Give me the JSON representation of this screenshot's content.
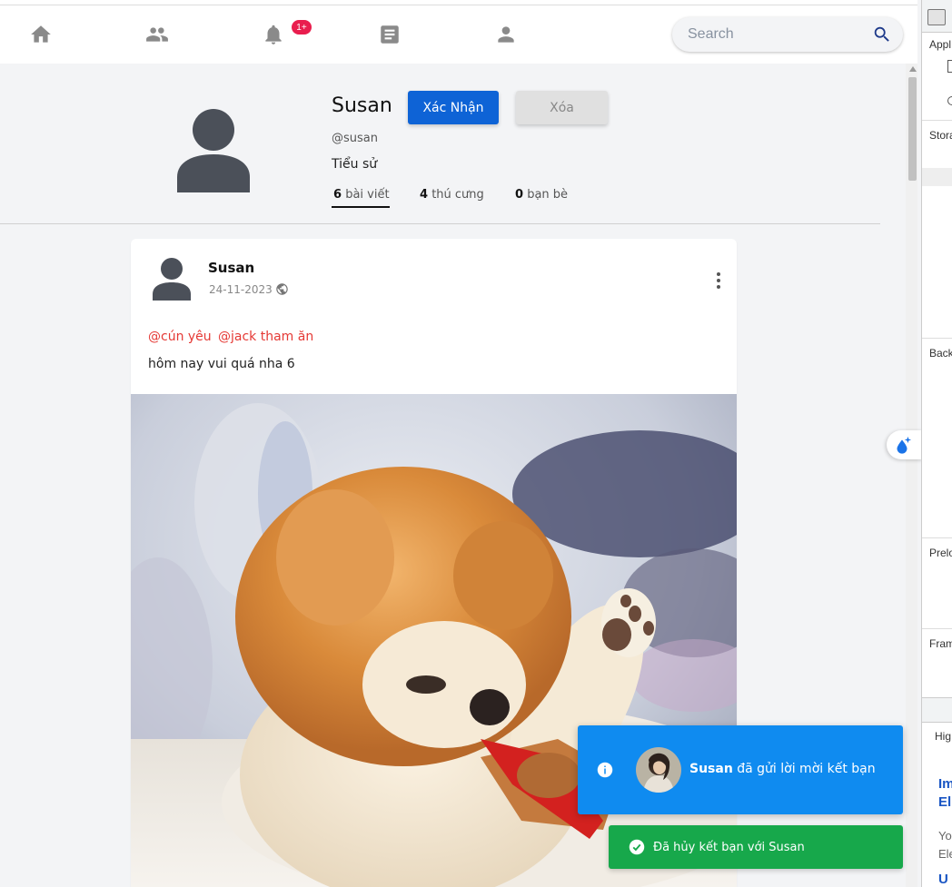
{
  "nav": {
    "notification_badge": "1+",
    "icons": [
      "home-icon",
      "friends-icon",
      "bell-icon",
      "article-icon",
      "person-icon"
    ],
    "search_placeholder": "Search"
  },
  "profile": {
    "name": "Susan",
    "handle": "@susan",
    "bio": "Tiểu sử",
    "confirm_label": "Xác Nhận",
    "delete_label": "Xóa",
    "stats": [
      {
        "count": "6",
        "label": "bài viết"
      },
      {
        "count": "4",
        "label": "thú cưng"
      },
      {
        "count": "0",
        "label": "bạn bè"
      }
    ]
  },
  "post": {
    "author": "Susan",
    "date": "24-11-2023",
    "tags": [
      "@cún yêu",
      "@jack tham ăn"
    ],
    "text": "hôm nay vui quá nha 6"
  },
  "toasts": {
    "friend_request": {
      "name": "Susan",
      "text": "đã gửi lời mời kết bạn"
    },
    "unfriend": {
      "text": "Đã hủy kết bạn với Susan"
    }
  },
  "devtools": {
    "sections": [
      "Appl",
      "Stora",
      "Back",
      "Prelo",
      "Fram"
    ],
    "hig": "Hig",
    "heading": [
      "Im",
      "El"
    ],
    "body": [
      "Yo",
      "Ele"
    ],
    "footer": "U"
  },
  "colors": {
    "primary": "#0e63d6",
    "danger_tag": "#e53935",
    "toast_info": "#0f8bf0",
    "toast_success": "#17a84b",
    "badge": "#e91e4e"
  }
}
